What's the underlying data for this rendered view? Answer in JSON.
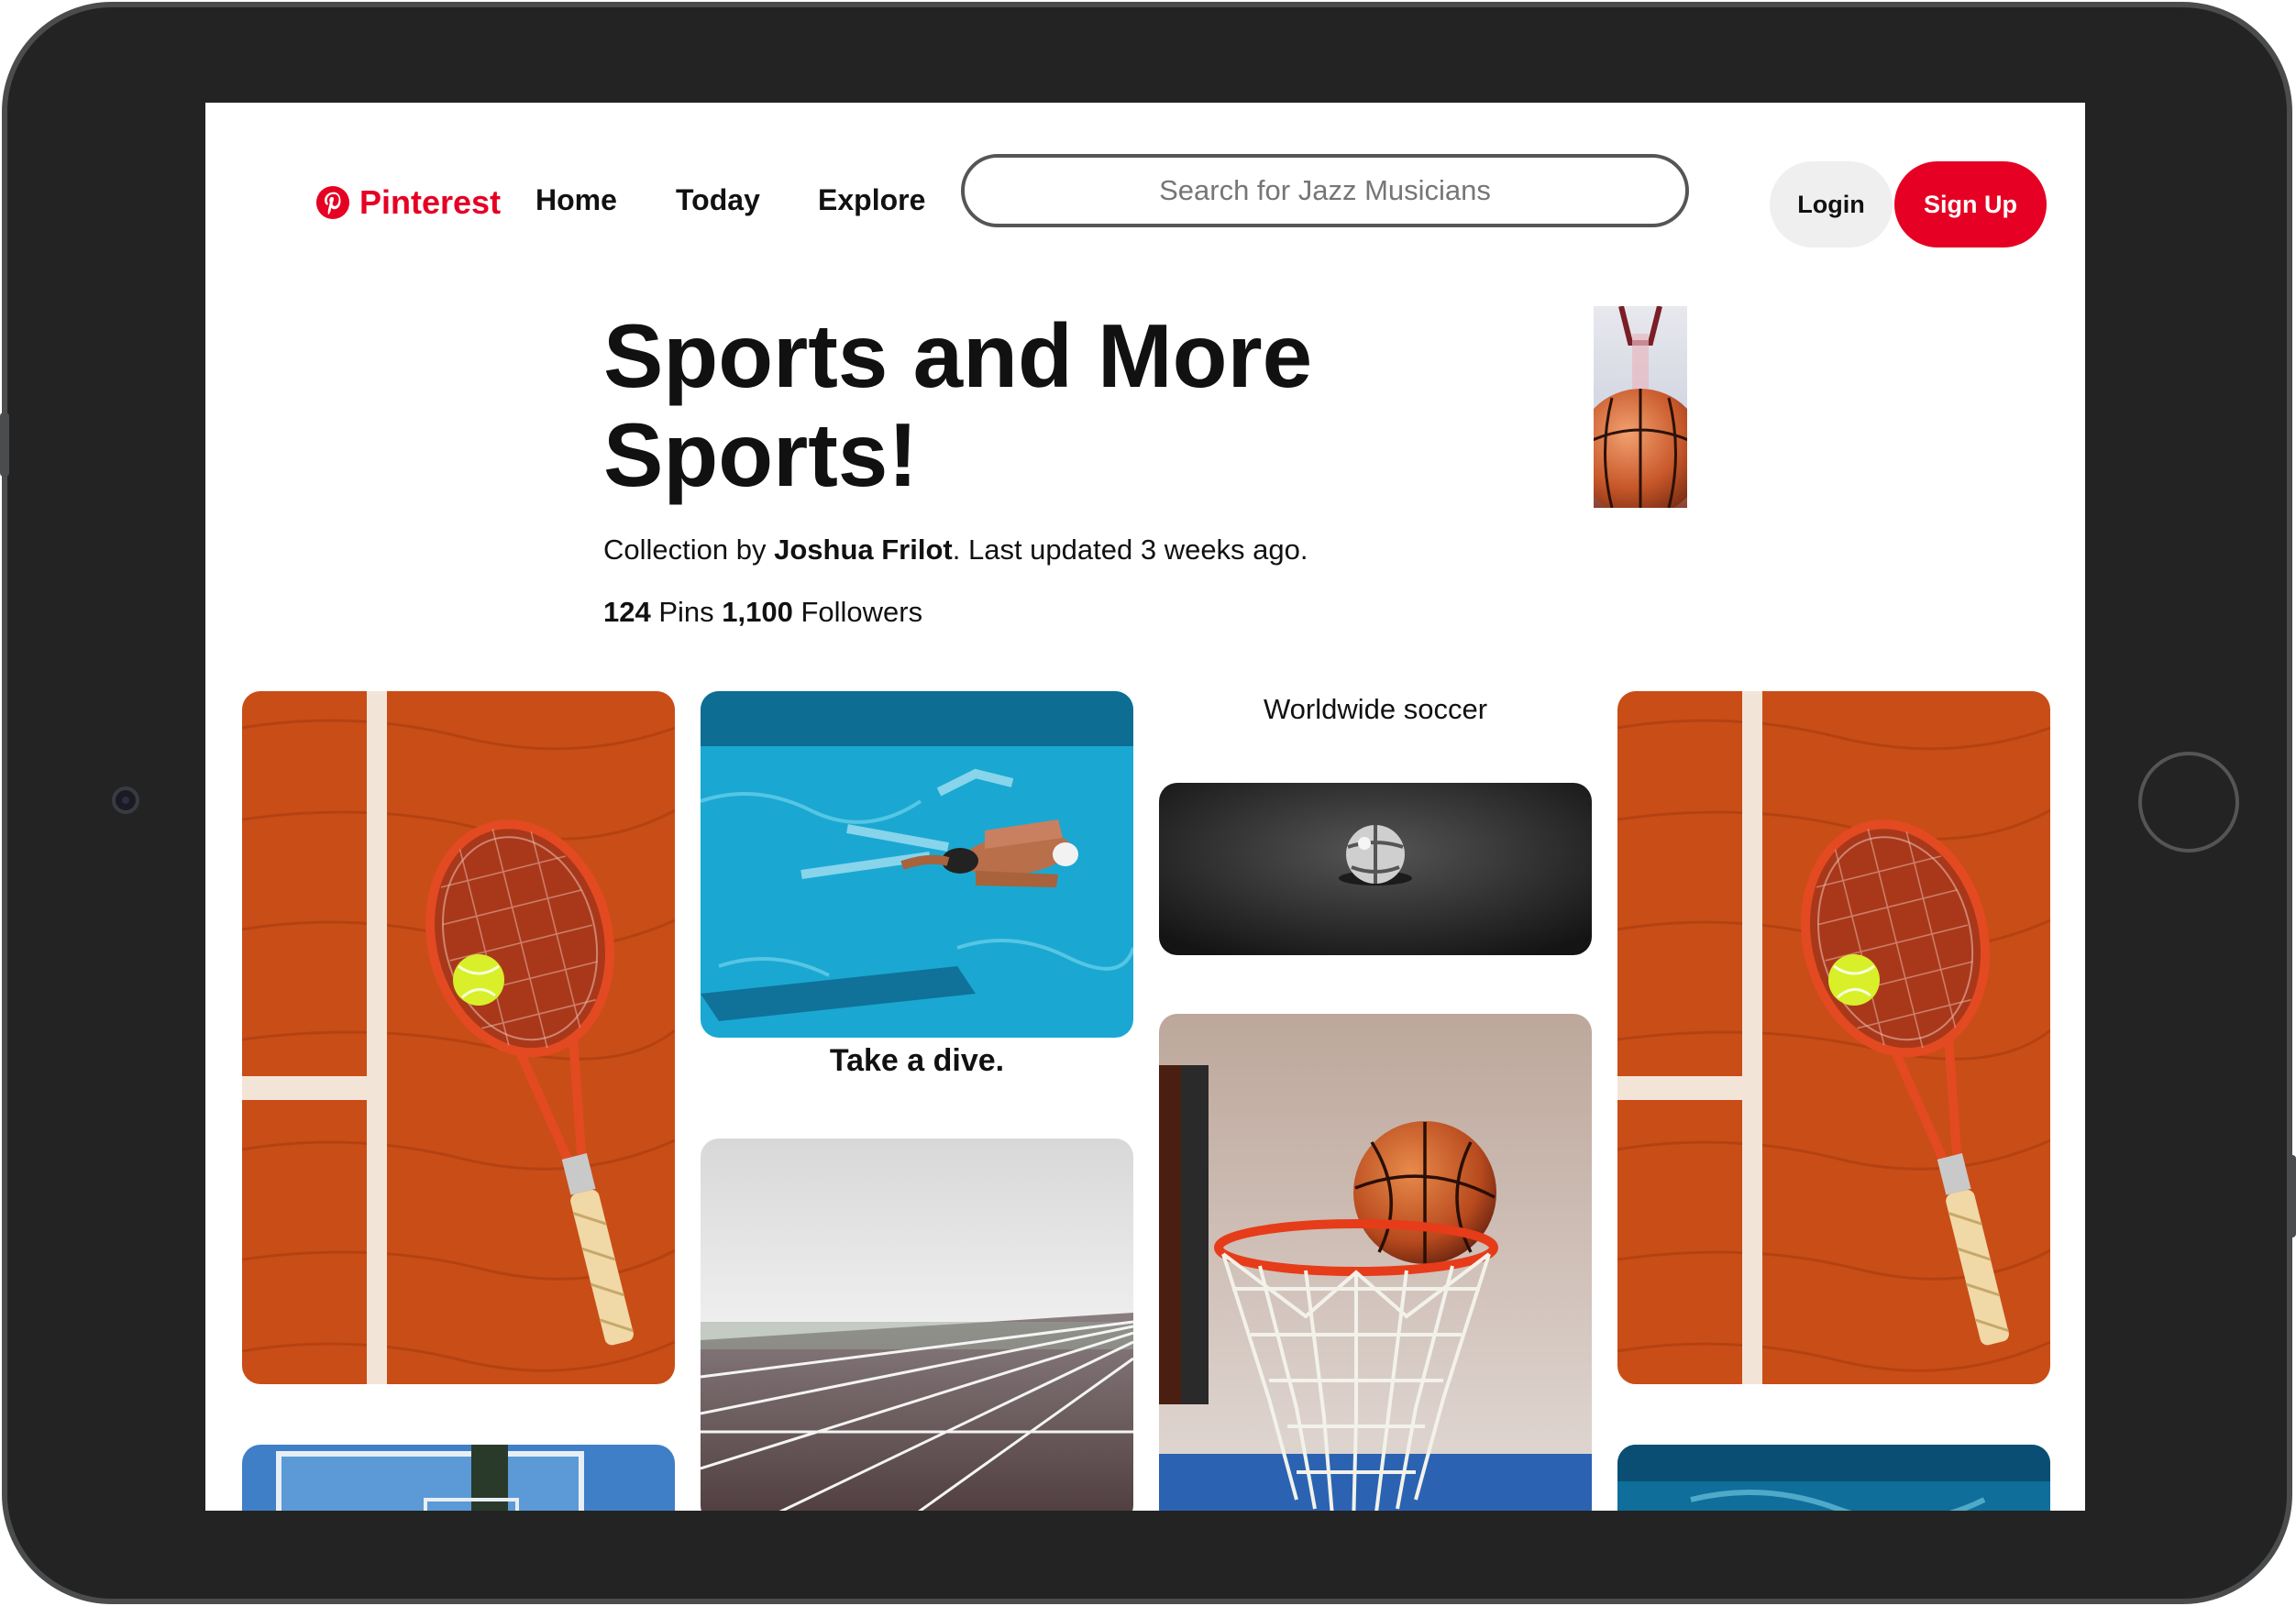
{
  "header": {
    "brand": "Pinterest",
    "nav": [
      {
        "label": "Home"
      },
      {
        "label": "Today"
      },
      {
        "label": "Explore"
      }
    ],
    "search_placeholder": "Search for Jazz Musicians",
    "login_label": "Login",
    "signup_label": "Sign Up",
    "brand_color": "#e60023"
  },
  "board": {
    "title": "Sports and More Sports!",
    "byline_prefix": "Collection by ",
    "author": "Joshua Frilot",
    "byline_suffix": ". Last updated 3 weeks ago.",
    "pins_count": "124",
    "pins_label": " Pins ",
    "followers_count": "1,100",
    "followers_label": " Followers"
  },
  "pins": [
    {
      "image": "tennis-racket-on-clay-court"
    },
    {
      "image": "swimmer-in-pool",
      "caption": "Take a dive."
    },
    {
      "image": "track-lanes-in-fog"
    },
    {
      "title": "Worldwide soccer",
      "image": "ball-on-dark-ground"
    },
    {
      "image": "basketball-in-hoop"
    },
    {
      "image": "tennis-racket-on-clay-court"
    },
    {
      "image": "basketball-backboard"
    },
    {
      "image": "swimmer-in-pool"
    }
  ]
}
